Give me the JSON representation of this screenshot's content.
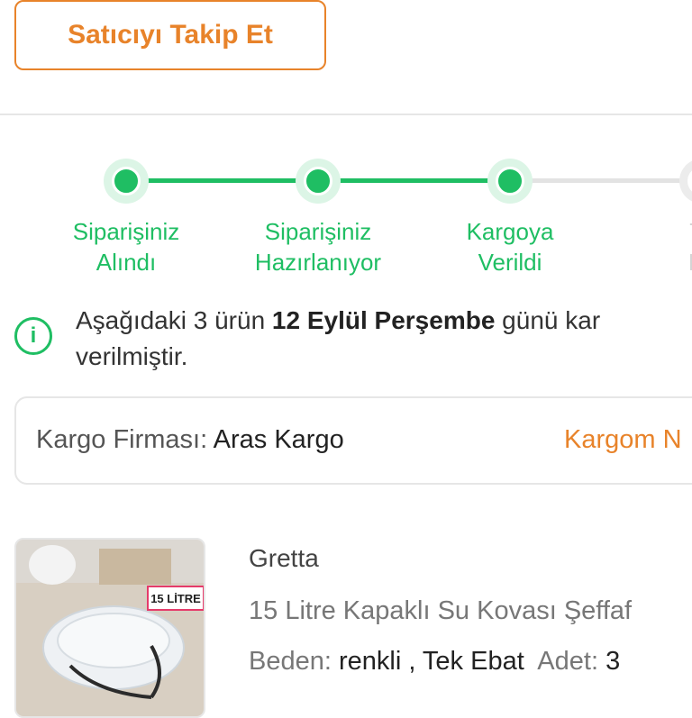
{
  "follow_button": "Satıcıyı Takip Et",
  "stepper": {
    "steps": [
      {
        "label_line1": "Siparişiniz",
        "label_line2": "Alındı"
      },
      {
        "label_line1": "Siparişiniz",
        "label_line2": "Hazırlanıyor"
      },
      {
        "label_line1": "Kargoya",
        "label_line2": "Verildi"
      },
      {
        "label_line1": "Te",
        "label_line2": "Ec"
      }
    ],
    "active_color": "#1fbe63",
    "pending_color": "#e3e3e3"
  },
  "info": {
    "icon": "info-icon",
    "prefix": "Aşağıdaki 3 ürün ",
    "date": "12 Eylül Perşembe",
    "suffix": " günü kar",
    "line2": "verilmiştir."
  },
  "cargo": {
    "label": "Kargo Firması:",
    "company": "Aras Kargo",
    "link": "Kargom N"
  },
  "product": {
    "brand": "Gretta",
    "name": "15 Litre Kapaklı Su Kovası Şeffaf",
    "variant_label": "Beden:",
    "variant_value": "renkli , Tek Ebat",
    "qty_label": "Adet:",
    "qty_value": "3",
    "image_badge": "15 LİTRE"
  },
  "accent_color": "#e8832a"
}
